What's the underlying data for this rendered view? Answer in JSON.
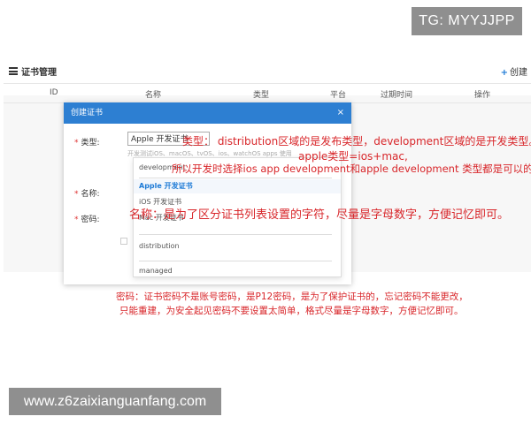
{
  "watermark_top": "TG: MYYJJPP",
  "watermark_bottom": "www.z6zaixianguanfang.com",
  "page": {
    "title": "证书管理",
    "create_label": "创建"
  },
  "table": {
    "columns": [
      "ID",
      "名称",
      "类型",
      "平台",
      "过期时间",
      "操作"
    ]
  },
  "modal": {
    "title": "创建证书",
    "close": "×",
    "type_label": "类型:",
    "type_value": "Apple 开发证书",
    "type_hint": "开发测试iOS、macOS、tvOS、ios、watchOS apps 使用",
    "name_label": "名称:",
    "password_label": "密码:",
    "dropdown_options": [
      "development",
      "Apple 开发证书",
      "iOS 开发证书",
      "Mac 开发证书",
      "distribution",
      "managed"
    ],
    "selected_option": "Apple 开发证书"
  },
  "annotations": {
    "type_line": "类型：  distribution区域的是发布类型，development区域的是开发类型。",
    "apple_line": "apple类型=ios+mac,",
    "dev_line": "所以开发时选择ios app development和apple development 类型都是可以的",
    "name_line": "名称：是为了区分证书列表设置的字符，尽量是字母数字，方便记忆即可。",
    "password_line1": "密码：证书密码不是账号密码，是P12密码，是为了保护证书的，忘记密码不能更改，",
    "password_line2": "只能重建，为安全起见密码不要设置太简单，格式尽量是字母数字，方便记忆即可。"
  },
  "colors": {
    "accent": "#2d7fd2",
    "annotation": "#d8262a"
  }
}
